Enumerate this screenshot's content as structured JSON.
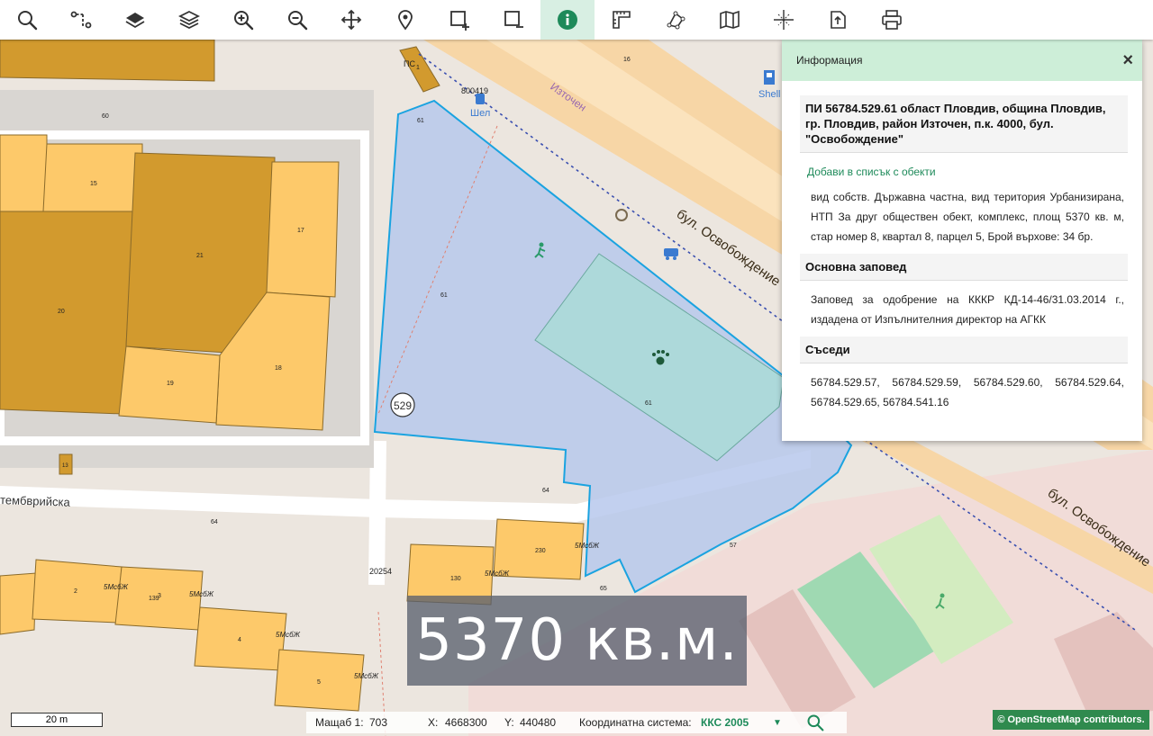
{
  "toolbar": {
    "tools": [
      {
        "name": "search-tool",
        "icon": "search-icon"
      },
      {
        "name": "route-tool",
        "icon": "route-icon"
      },
      {
        "name": "layers-single-tool",
        "icon": "layer-icon"
      },
      {
        "name": "layers-tool",
        "icon": "layers-icon"
      },
      {
        "name": "zoom-in-tool",
        "icon": "zoom-in-icon"
      },
      {
        "name": "zoom-out-tool",
        "icon": "zoom-out-icon"
      },
      {
        "name": "pan-tool",
        "icon": "pan-arrows-icon"
      },
      {
        "name": "marker-tool",
        "icon": "map-pin-icon"
      },
      {
        "name": "select-add-tool",
        "icon": "select-add-icon"
      },
      {
        "name": "select-remove-tool",
        "icon": "select-remove-icon"
      },
      {
        "name": "info-tool",
        "icon": "info-icon",
        "active": true
      },
      {
        "name": "measure-tool",
        "icon": "ruler-icon"
      },
      {
        "name": "polygon-tool",
        "icon": "polygon-icon"
      },
      {
        "name": "map-tool",
        "icon": "folded-map-icon"
      },
      {
        "name": "crosshair-tool",
        "icon": "crosshair-icon"
      },
      {
        "name": "export-tool",
        "icon": "export-icon"
      },
      {
        "name": "print-tool",
        "icon": "printer-icon"
      }
    ],
    "accent": "#1e8a5a"
  },
  "info_panel": {
    "header": "Информация",
    "close": "×",
    "parcel_title": "ПИ 56784.529.61 област Пловдив, община Пловдив, гр. Пловдив, район Източен, п.к. 4000, бул. \"Освобождение\"",
    "add_link": "Добави в списък с обекти",
    "details": "вид собств. Държавна частна, вид територия Урбанизирана, НТП За друг обществен обект, комплекс, площ 5370 кв. м, стар номер 8, квартал 8, парцел 5, Брой върхове: 34 бр.",
    "order_title": "Основна заповед",
    "order_text": "Заповед за одобрение на КККР КД-14-46/31.03.2014 г., издадена от Изпълнителния директор на АГКК",
    "neighbors_title": "Съседи",
    "neighbors_text": "56784.529.57, 56784.529.59, 56784.529.60, 56784.529.64, 56784.529.65, 56784.541.16"
  },
  "map": {
    "area_label": "5370 кв.м.",
    "block_badge": "529",
    "street_1": "бул. Освобождение",
    "street_2": "бул. Освобождение",
    "street_3": "тембврийска",
    "street_4": "Източен",
    "poi_shell_1": "Шел",
    "poi_shell_2": "Shell",
    "point_1": "800419",
    "point_2": "20254",
    "building_labels": [
      "15",
      "17",
      "21",
      "20",
      "19",
      "18",
      "13"
    ],
    "parcel_labels": [
      "60",
      "61",
      "16",
      "61",
      "61",
      "64",
      "64",
      "65",
      "57"
    ],
    "residential": [
      {
        "num": "2",
        "type": "5МсбЖ"
      },
      {
        "num": "3",
        "type": "5МсбЖ"
      },
      {
        "num": "4",
        "type": "5МсбЖ"
      },
      {
        "num": "5",
        "type": "5МсбЖ"
      },
      {
        "num": "130",
        "type": "5МсбЖ"
      },
      {
        "num": "230",
        "type": "5МсбЖ"
      },
      {
        "num": "139",
        "type": ""
      }
    ],
    "ps_label": "ПС",
    "ps_num": "1"
  },
  "status": {
    "scale_bar": "20 m",
    "scale_label": "Мащаб 1:",
    "scale_value": "703",
    "x_label": "X:",
    "x_value": "4668300",
    "y_label": "Y:",
    "y_value": "440480",
    "crs_label": "Координатна система:",
    "crs_value": "ККС 2005",
    "dropdown": "▼"
  },
  "attribution": "© OpenStreetMap contributors."
}
